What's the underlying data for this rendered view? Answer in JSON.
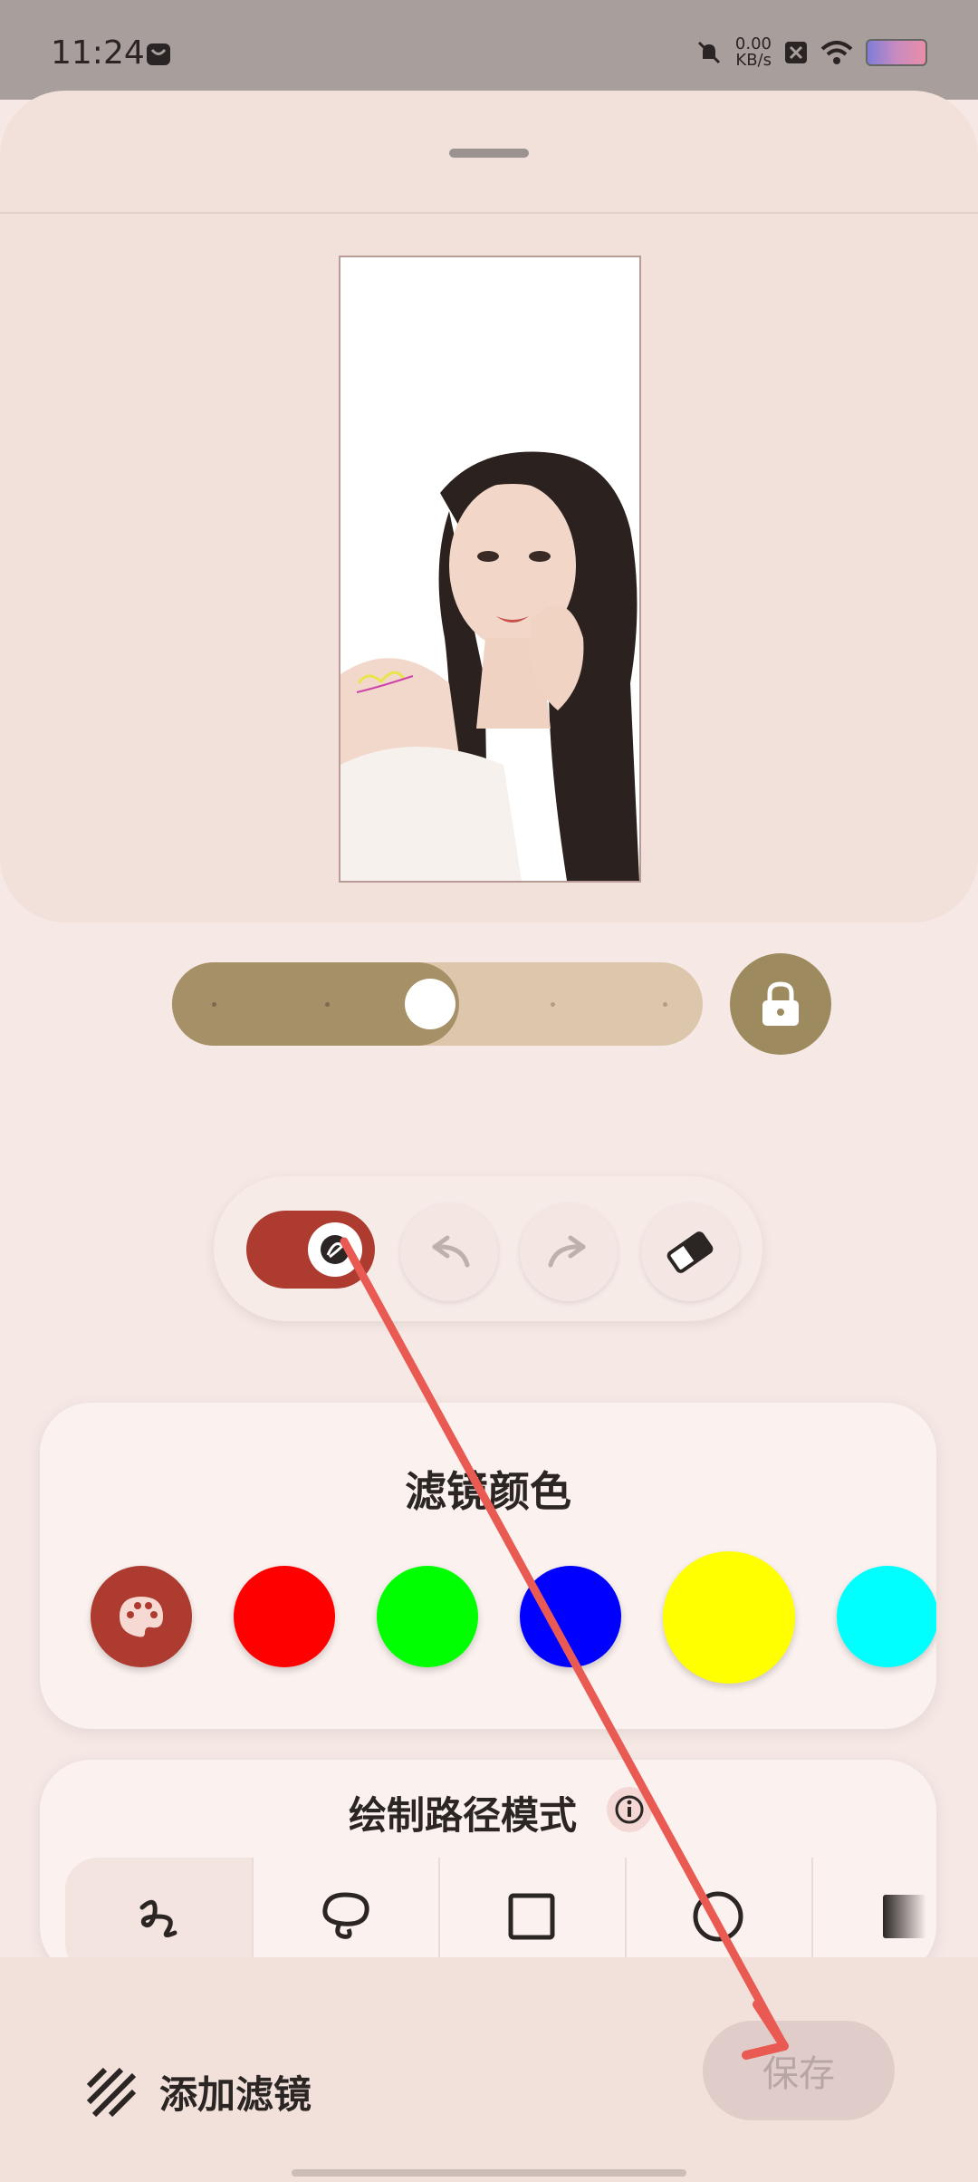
{
  "status_bar": {
    "time": "11:24",
    "net_speed": "0.00",
    "net_unit": "KB/s"
  },
  "editor": {
    "slider": {
      "value_fraction": 0.52,
      "dot_count": 5
    },
    "filter_color_title": "滤镜颜色",
    "swatches": [
      {
        "name": "palette",
        "color": "#ad3b2f"
      },
      {
        "name": "red",
        "color": "#ff0000"
      },
      {
        "name": "green",
        "color": "#00ff00"
      },
      {
        "name": "blue",
        "color": "#0000ff"
      },
      {
        "name": "yellow",
        "color": "#ffff00"
      },
      {
        "name": "cyan",
        "color": "#00ffff"
      }
    ],
    "draw_path_title": "绘制路径模式",
    "modes": [
      "freehand",
      "lasso",
      "rectangle",
      "circle",
      "gradient"
    ]
  },
  "bottom": {
    "add_filter_label": "添加滤镜",
    "save_label": "保存"
  },
  "colors": {
    "accent": "#ad3b2f",
    "slider_fill": "#a59067",
    "arrow": "#e85a52"
  }
}
